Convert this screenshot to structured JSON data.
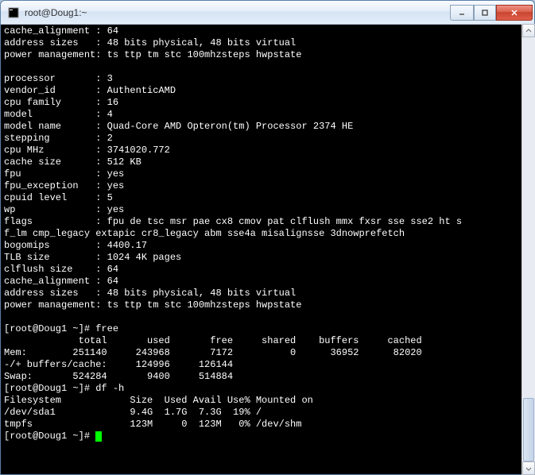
{
  "window": {
    "title": "root@Doug1:~",
    "icon_glyph": "terminal-icon"
  },
  "terminal_lines": [
    "cache_alignment : 64",
    "address sizes   : 48 bits physical, 48 bits virtual",
    "power management: ts ttp tm stc 100mhzsteps hwpstate",
    "",
    "processor       : 3",
    "vendor_id       : AuthenticAMD",
    "cpu family      : 16",
    "model           : 4",
    "model name      : Quad-Core AMD Opteron(tm) Processor 2374 HE",
    "stepping        : 2",
    "cpu MHz         : 3741020.772",
    "cache size      : 512 KB",
    "fpu             : yes",
    "fpu_exception   : yes",
    "cpuid level     : 5",
    "wp              : yes",
    "flags           : fpu de tsc msr pae cx8 cmov pat clflush mmx fxsr sse sse2 ht s",
    "f_lm cmp_legacy extapic cr8_legacy abm sse4a misalignsse 3dnowprefetch",
    "bogomips        : 4400.17",
    "TLB size        : 1024 4K pages",
    "clflush size    : 64",
    "cache_alignment : 64",
    "address sizes   : 48 bits physical, 48 bits virtual",
    "power management: ts ttp tm stc 100mhzsteps hwpstate",
    "",
    "[root@Doug1 ~]# free",
    "             total       used       free     shared    buffers     cached",
    "Mem:        251140     243968       7172          0      36952      82020",
    "-/+ buffers/cache:     124996     126144",
    "Swap:       524284       9400     514884",
    "[root@Doug1 ~]# df -h",
    "Filesystem            Size  Used Avail Use% Mounted on",
    "/dev/sda1             9.4G  1.7G  7.3G  19% /",
    "tmpfs                 123M     0  123M   0% /dev/shm"
  ],
  "prompt": "[root@Doug1 ~]# "
}
